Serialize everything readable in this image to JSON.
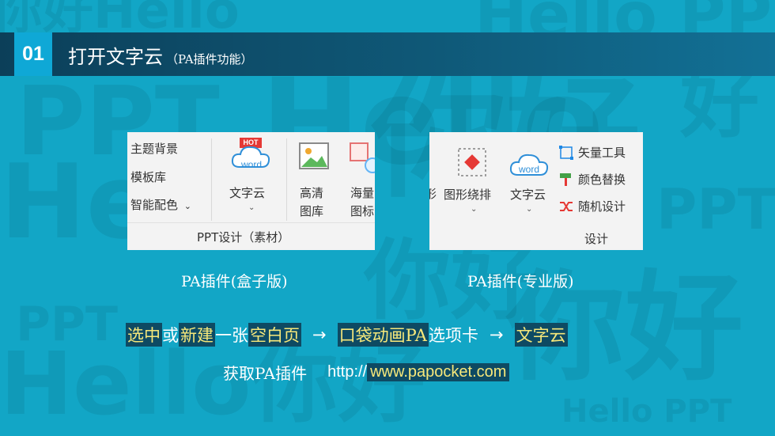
{
  "header": {
    "number": "01",
    "title": "打开文字云",
    "subtitle": "（PA插件功能）"
  },
  "panel_left": {
    "menu_items": [
      "主题背景",
      "模板库",
      "智能配色"
    ],
    "menu_chevron": "⌄",
    "hot_badge": "HOT",
    "word_badge": "word",
    "btn_wordcloud": "文字云",
    "btn_gallery_l1": "高清",
    "btn_gallery_l2": "图库",
    "btn_poster_l1": "海量",
    "btn_poster_l2": "图标",
    "group_label": "PPT设计（素材）"
  },
  "panel_right": {
    "cut_text": "形",
    "btn_layout": "图形绕排",
    "word_badge": "word",
    "btn_wordcloud": "文字云",
    "menu_items": [
      "矢量工具",
      "颜色替换",
      "随机设计"
    ],
    "group_label": "设计"
  },
  "captions": {
    "left": "PA插件(盒子版)",
    "right": "PA插件(专业版)"
  },
  "steps": {
    "s1": "选中",
    "s2": "或",
    "s3": "新建",
    "s4": "一张",
    "s5": "空白页",
    "s6": "口袋动画",
    "s7": "PA",
    "s8": "选项卡",
    "s9": "文字云",
    "arrow": "→"
  },
  "link_line": {
    "label": "获取PA插件",
    "protocol": "http://",
    "domain": "www.papocket.com"
  },
  "colors": {
    "background": "#12a6c6",
    "header_dark": "#0c3f59",
    "number_box": "#0fa8d6",
    "highlight_bg": "#0e4a63",
    "highlight_text": "#f7e87a",
    "hot_red": "#e53935"
  }
}
